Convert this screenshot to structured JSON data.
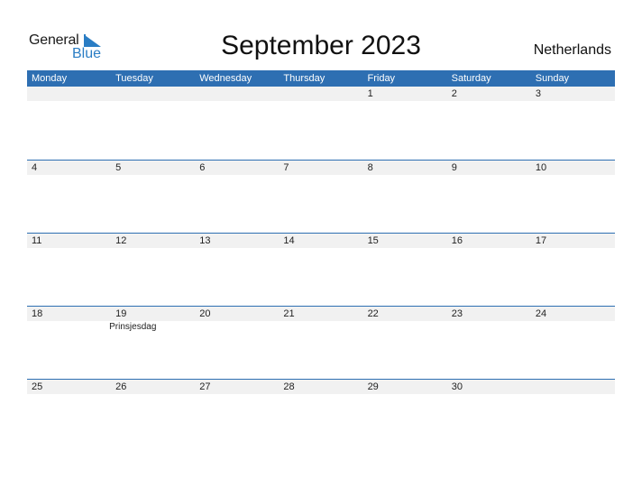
{
  "logo": {
    "word1": "General",
    "word2": "Blue"
  },
  "title": "September 2023",
  "country": "Netherlands",
  "colors": {
    "accent": "#2e6fb2",
    "band": "#f1f1f1",
    "logo_blue": "#2a7dc4"
  },
  "weekdays": [
    "Monday",
    "Tuesday",
    "Wednesday",
    "Thursday",
    "Friday",
    "Saturday",
    "Sunday"
  ],
  "weeks": [
    [
      {
        "day": ""
      },
      {
        "day": ""
      },
      {
        "day": ""
      },
      {
        "day": ""
      },
      {
        "day": "1"
      },
      {
        "day": "2"
      },
      {
        "day": "3"
      }
    ],
    [
      {
        "day": "4"
      },
      {
        "day": "5"
      },
      {
        "day": "6"
      },
      {
        "day": "7"
      },
      {
        "day": "8"
      },
      {
        "day": "9"
      },
      {
        "day": "10"
      }
    ],
    [
      {
        "day": "11"
      },
      {
        "day": "12"
      },
      {
        "day": "13"
      },
      {
        "day": "14"
      },
      {
        "day": "15"
      },
      {
        "day": "16"
      },
      {
        "day": "17"
      }
    ],
    [
      {
        "day": "18"
      },
      {
        "day": "19",
        "event": "Prinsjesdag"
      },
      {
        "day": "20"
      },
      {
        "day": "21"
      },
      {
        "day": "22"
      },
      {
        "day": "23"
      },
      {
        "day": "24"
      }
    ],
    [
      {
        "day": "25"
      },
      {
        "day": "26"
      },
      {
        "day": "27"
      },
      {
        "day": "28"
      },
      {
        "day": "29"
      },
      {
        "day": "30"
      },
      {
        "day": ""
      }
    ]
  ]
}
